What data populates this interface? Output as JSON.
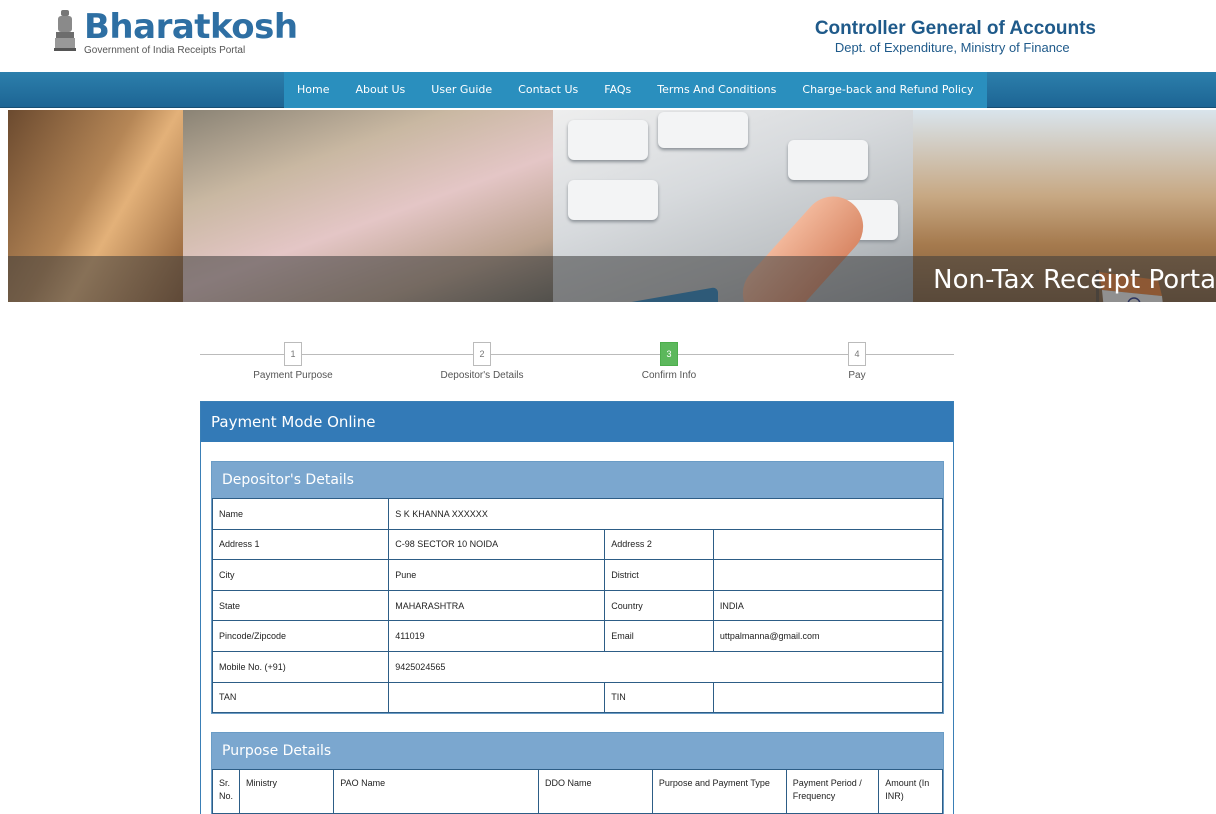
{
  "header": {
    "brand_name": "Bharatkosh",
    "brand_sub": "Government of India Receipts Portal",
    "org_title": "Controller General of Accounts",
    "org_sub": "Dept. of Expenditure, Ministry of Finance"
  },
  "nav": {
    "items": [
      "Home",
      "About Us",
      "User Guide",
      "Contact Us",
      "FAQs",
      "Terms And Conditions",
      "Charge-back and Refund Policy"
    ]
  },
  "banner": {
    "text": "Non-Tax Receipt Porta",
    "key_label": "pay"
  },
  "steps": [
    {
      "num": "1",
      "label": "Payment Purpose",
      "active": false
    },
    {
      "num": "2",
      "label": "Depositor's Details",
      "active": false
    },
    {
      "num": "3",
      "label": "Confirm Info",
      "active": true
    },
    {
      "num": "4",
      "label": "Pay",
      "active": false
    }
  ],
  "panel": {
    "title": "Payment Mode Online"
  },
  "depositor": {
    "title": "Depositor's Details",
    "name_label": "Name",
    "name_value": "S K KHANNA XXXXXX",
    "address1_label": "Address 1",
    "address1_value": "C-98 SECTOR 10 NOIDA",
    "address2_label": "Address 2",
    "address2_value": "",
    "city_label": "City",
    "city_value": "Pune",
    "district_label": "District",
    "district_value": "",
    "state_label": "State",
    "state_value": "MAHARASHTRA",
    "country_label": "Country",
    "country_value": "INDIA",
    "pincode_label": "Pincode/Zipcode",
    "pincode_value": "411019",
    "email_label": "Email",
    "email_value": "uttpalmanna@gmail.com",
    "mobile_label": "Mobile No. (+91)",
    "mobile_value": "9425024565",
    "tan_label": "TAN",
    "tan_value": "",
    "tin_label": "TIN",
    "tin_value": ""
  },
  "purpose": {
    "title": "Purpose Details",
    "headers": [
      "Sr. No.",
      "Ministry",
      "PAO Name",
      "DDO Name",
      "Purpose and Payment Type",
      "Payment Period / Frequency",
      "Amount (In INR)"
    ]
  },
  "colors": {
    "brand": "#2e6fa3",
    "nav": "#1d6594",
    "panel_head": "#337ab7",
    "sub_head": "#7ba7cf",
    "active_step": "#5cb85c"
  }
}
